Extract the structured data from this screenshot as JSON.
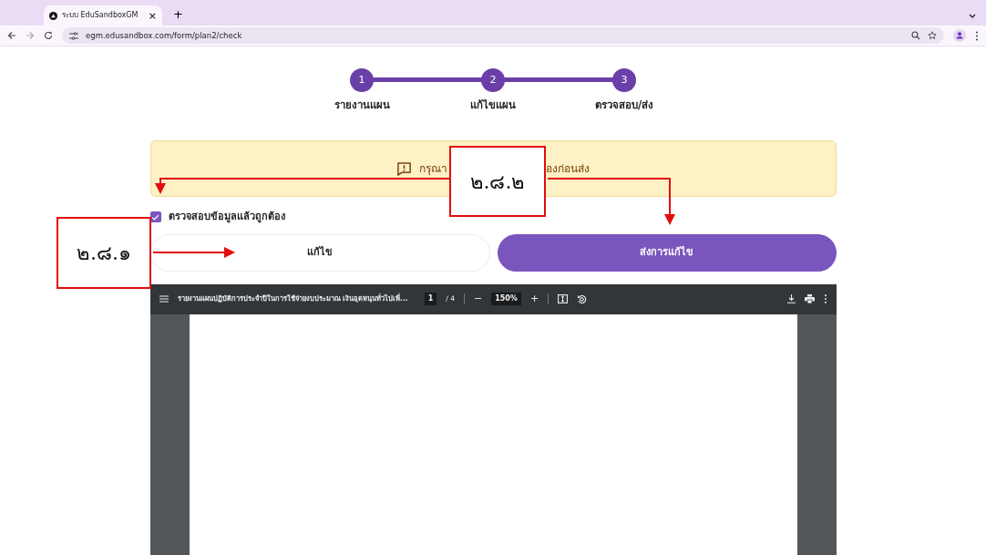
{
  "browser": {
    "tab_title": "ระบบ EduSandboxGM",
    "close": "×",
    "new_tab": "+",
    "url": "egm.edusandbox.com/form/plan2/check"
  },
  "stepper": [
    {
      "number": "1",
      "label": "รายงานแผน"
    },
    {
      "number": "2",
      "label": "แก้ไขแผน"
    },
    {
      "number": "3",
      "label": "ตรวจสอบ/ส่ง"
    }
  ],
  "alert": {
    "text_start": "กรุณา",
    "text_end": "องก่อนส่ง"
  },
  "confirm": {
    "label": "ตรวจสอบข้อมูลแล้วถูกต้อง",
    "checked": true
  },
  "buttons": [
    {
      "label": "แก้ไข",
      "kind": "outline"
    },
    {
      "label": "ส่งการแก้ไข",
      "kind": "primary"
    }
  ],
  "pdf_viewer": {
    "title": "รายงานแผนปฏิบัติการประจำปีในการใช้จ่ายงบประมาณ เงินอุดหนุนทั่วไปเพื่...",
    "page": "1",
    "page_count": "/ 4",
    "zoom_out": "−",
    "zoom": "150%",
    "zoom_in": "+"
  },
  "annotations": [
    {
      "label": "๒.๘.๒"
    },
    {
      "label": "๒.๘.๑"
    }
  ]
}
